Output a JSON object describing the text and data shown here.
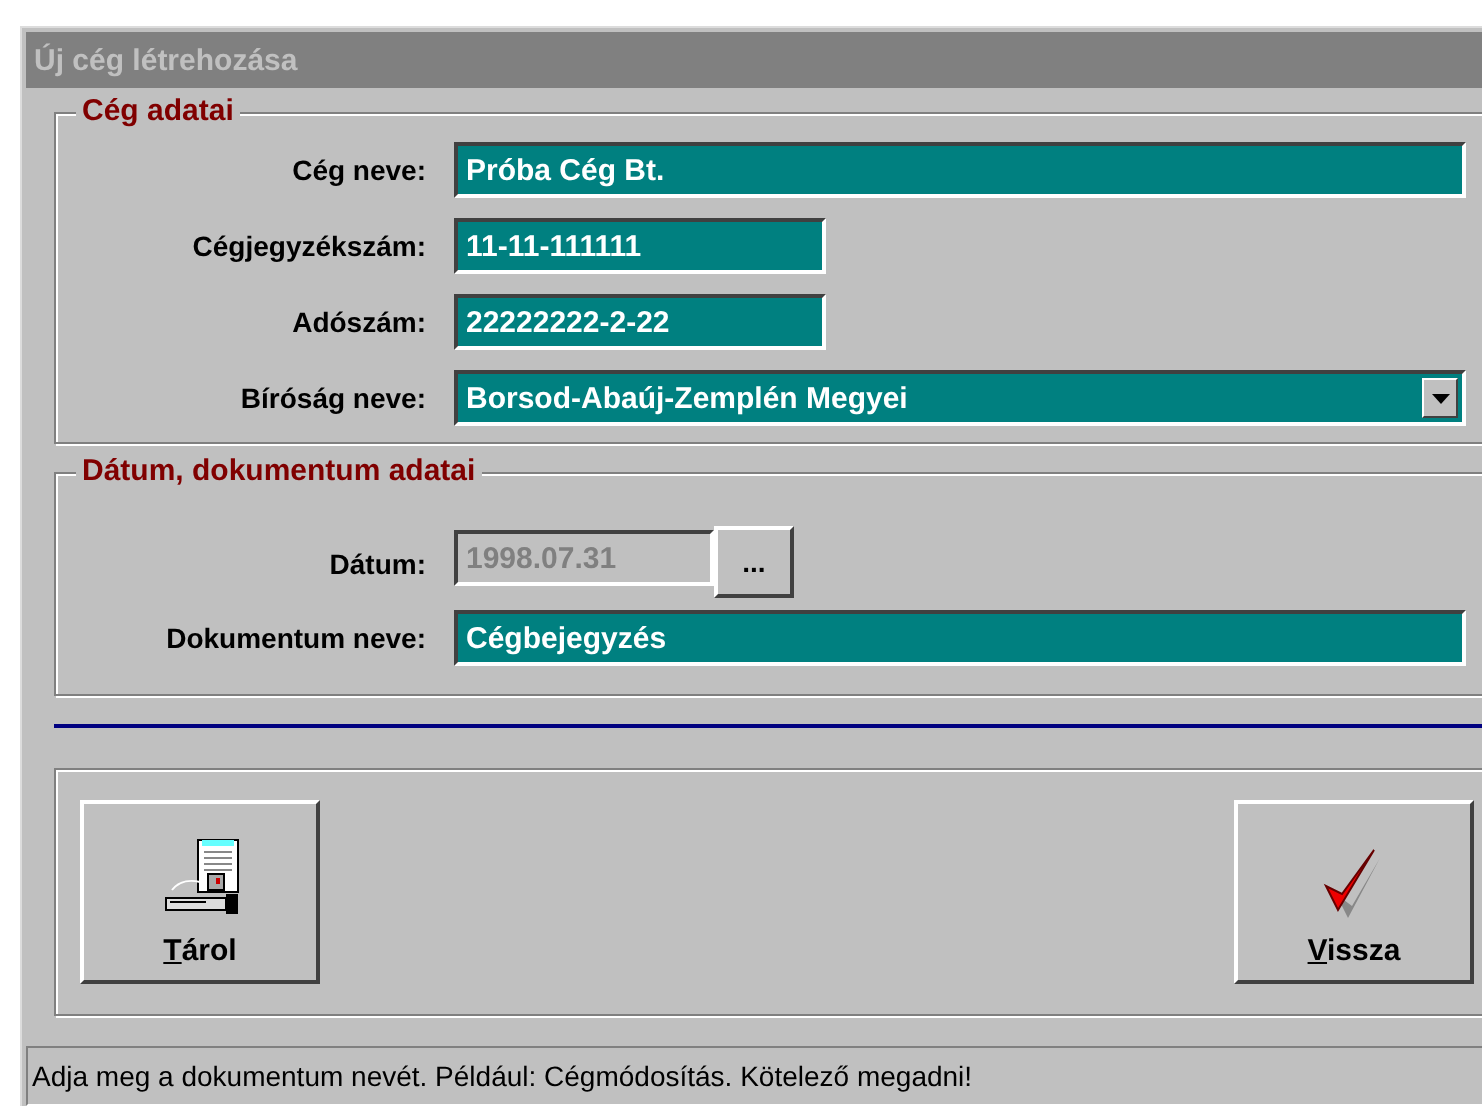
{
  "window": {
    "title": "Új cég létrehozása",
    "active": false
  },
  "groups": [
    {
      "title": "Cég adatai",
      "fields": [
        {
          "kind": "wide",
          "label": "Cég neve:",
          "value": "Próba Cég Bt.",
          "disabled": false
        },
        {
          "kind": "short",
          "label": "Cégjegyzékszám:",
          "value": "11-11-111111",
          "disabled": false
        },
        {
          "kind": "short",
          "label": "Adószám:",
          "value": "22222222-2-22",
          "disabled": false
        },
        {
          "kind": "combo",
          "label": "Bíróság neve:",
          "value": "Borsod-Abaúj-Zemplén Megyei",
          "disabled": false
        }
      ]
    },
    {
      "title": "Dátum, dokumentum adatai",
      "fields": [
        {
          "kind": "date",
          "label": "Dátum:",
          "value": "1998.07.31",
          "disabled": true,
          "button": "..."
        },
        {
          "kind": "wide",
          "label": "Dokumentum neve:",
          "value": "Cégbejegyzés",
          "disabled": false
        }
      ]
    }
  ],
  "buttons": [
    {
      "kind": "save",
      "label": "Tárol"
    },
    {
      "kind": "ok",
      "label": "Vissza"
    }
  ],
  "status_bar": "Adja meg a dokumentum nevét. Például: Cégmódosítás. Kötelező megadni!"
}
